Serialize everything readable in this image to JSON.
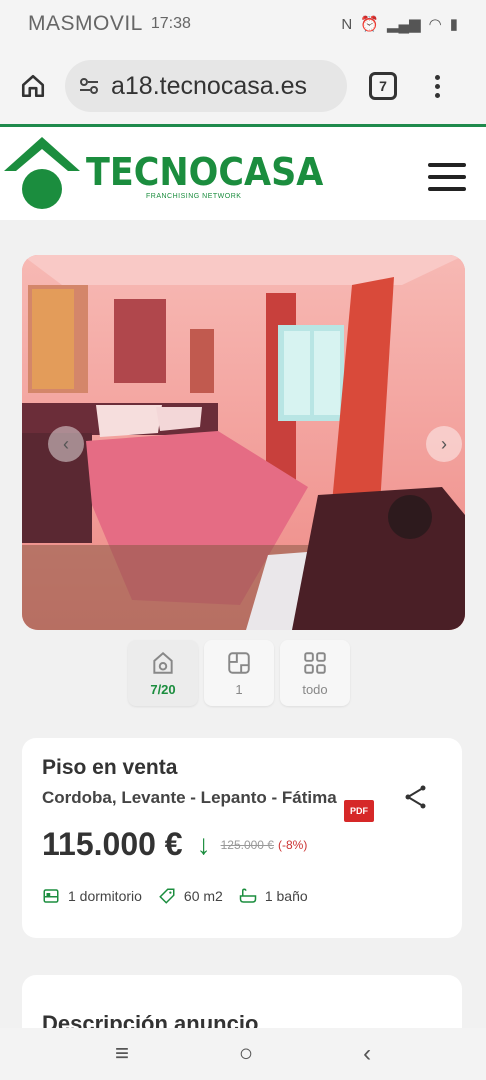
{
  "status_bar": {
    "carrier": "MASMOVIL",
    "time": "17:38"
  },
  "browser": {
    "url": "a18.tecnocasa.es",
    "tab_count": "7"
  },
  "site": {
    "brand": "TECNOCASA",
    "tagline": "FRANCHISING NETWORK"
  },
  "gallery": {
    "tabs": [
      {
        "label": "7/20",
        "icon": "camera-icon"
      },
      {
        "label": "1",
        "icon": "floorplan-icon"
      },
      {
        "label": "todo",
        "icon": "grid-icon"
      }
    ]
  },
  "listing": {
    "type": "Piso en venta",
    "location": "Cordoba, Levante - Lepanto - Fátima",
    "price": "115.000 €",
    "old_price": "125.000 €",
    "discount": "(-8%)",
    "pdf_label": "PDF",
    "features": [
      {
        "label": "1 dormitorio",
        "icon": "bed-icon"
      },
      {
        "label": "60 m2",
        "icon": "tag-icon"
      },
      {
        "label": "1 baño",
        "icon": "bath-icon"
      }
    ]
  },
  "description": {
    "title": "Descripción anuncio"
  },
  "colors": {
    "brand_green": "#1b8d3e",
    "discount_red": "#cc3333"
  }
}
